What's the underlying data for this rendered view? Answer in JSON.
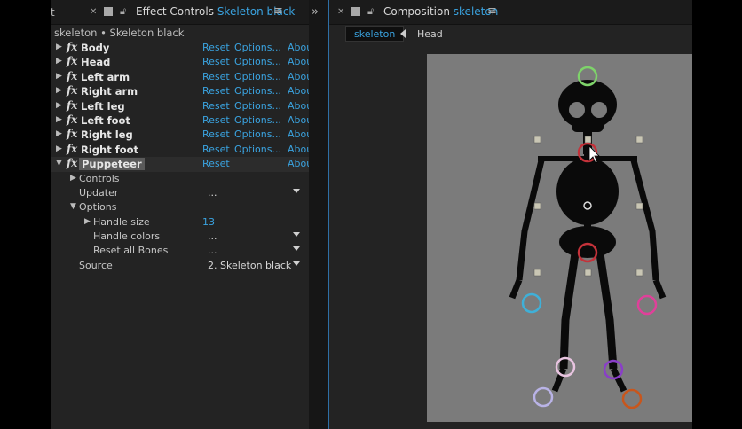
{
  "left_panel": {
    "prev_tab_fragment": "t",
    "tab_title": "Effect Controls",
    "tab_title_layer": "Skeleton black",
    "header": "skeleton • Skeleton black",
    "effects": [
      {
        "name": "Body",
        "reset": "Reset",
        "options": "Options...",
        "about": "Abou"
      },
      {
        "name": "Head",
        "reset": "Reset",
        "options": "Options...",
        "about": "Abou"
      },
      {
        "name": "Left arm",
        "reset": "Reset",
        "options": "Options...",
        "about": "Abou"
      },
      {
        "name": "Right arm",
        "reset": "Reset",
        "options": "Options...",
        "about": "Abou"
      },
      {
        "name": "Left leg",
        "reset": "Reset",
        "options": "Options...",
        "about": "Abou"
      },
      {
        "name": "Left foot",
        "reset": "Reset",
        "options": "Options...",
        "about": "Abou"
      },
      {
        "name": "Right leg",
        "reset": "Reset",
        "options": "Options...",
        "about": "Abou"
      },
      {
        "name": "Right foot",
        "reset": "Reset",
        "options": "Options...",
        "about": "Abou"
      }
    ],
    "puppeteer": {
      "name": "Puppeteer",
      "reset": "Reset",
      "about": "Abou"
    },
    "props": {
      "controls": "Controls",
      "updater": "Updater",
      "updater_value": "...",
      "options": "Options",
      "handle_size": "Handle size",
      "handle_size_value": "13",
      "handle_colors": "Handle colors",
      "handle_colors_value": "...",
      "reset_bones": "Reset all Bones",
      "reset_bones_value": "...",
      "source": "Source",
      "source_value": "2. Skeleton black"
    }
  },
  "right_panel": {
    "tab_title": "Composition",
    "tab_comp": "skeleton",
    "flow_active": "skeleton",
    "flow_child": "Head"
  },
  "colors": {
    "accent_blue": "#3aa3e0",
    "panel_bg": "#232323",
    "canvas_bg": "#7b7b7b",
    "handle_green": "#7ed36a",
    "handle_red": "#c4323a",
    "handle_cyan": "#3fb0d8",
    "handle_pink": "#e0409a",
    "handle_lightpink": "#e8c4e0",
    "handle_purple": "#8a3ec8",
    "handle_lavender": "#b9b3e6",
    "handle_orange": "#c8561c"
  }
}
